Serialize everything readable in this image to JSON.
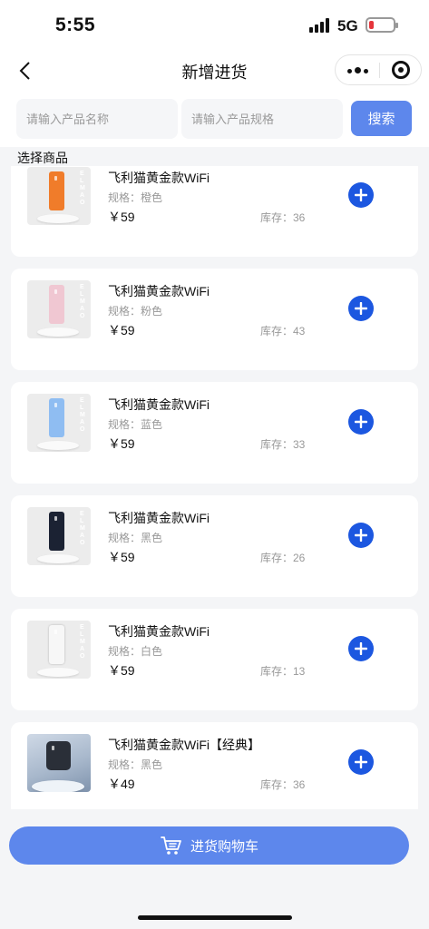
{
  "status_bar": {
    "time": "5:55",
    "network": "5G"
  },
  "nav": {
    "title": "新增进货"
  },
  "search": {
    "name_placeholder": "请输入产品名称",
    "spec_placeholder": "请输入产品规格",
    "button_label": "搜索"
  },
  "section_label": "选择商品",
  "products": [
    {
      "name": "飞利猫黄金款WiFi",
      "spec": "规格：橙色",
      "price": "￥59",
      "stock": "库存：36",
      "color": "#f07c2a",
      "brand_mark": "ELMAO"
    },
    {
      "name": "飞利猫黄金款WiFi",
      "spec": "规格：粉色",
      "price": "￥59",
      "stock": "库存：43",
      "color": "#f0c7d2",
      "brand_mark": "ELMAO"
    },
    {
      "name": "飞利猫黄金款WiFi",
      "spec": "规格：蓝色",
      "price": "￥59",
      "stock": "库存：33",
      "color": "#8fbdf2",
      "brand_mark": "ELMAO"
    },
    {
      "name": "飞利猫黄金款WiFi",
      "spec": "规格：黑色",
      "price": "￥59",
      "stock": "库存：26",
      "color": "#1b2233",
      "brand_mark": "ELMAO"
    },
    {
      "name": "飞利猫黄金款WiFi",
      "spec": "规格：白色",
      "price": "￥59",
      "stock": "库存：13",
      "color": "#f7f7f7",
      "brand_mark": "ELMAO"
    },
    {
      "name": "飞利猫黄金款WiFi【经典】",
      "spec": "规格：黑色",
      "price": "￥49",
      "stock": "库存：36",
      "color": "#2a2f38",
      "brand_mark": ""
    }
  ],
  "cart": {
    "label": "进货购物车"
  },
  "colors": {
    "accent": "#5d87ec",
    "add_button": "#1c57e0",
    "battery_low": "#e5353b"
  },
  "icons": {
    "back": "chevron-left-icon",
    "more": "more-dots-icon",
    "close": "target-circle-icon",
    "add": "plus-circle-icon",
    "cart": "shopping-cart-icon"
  }
}
